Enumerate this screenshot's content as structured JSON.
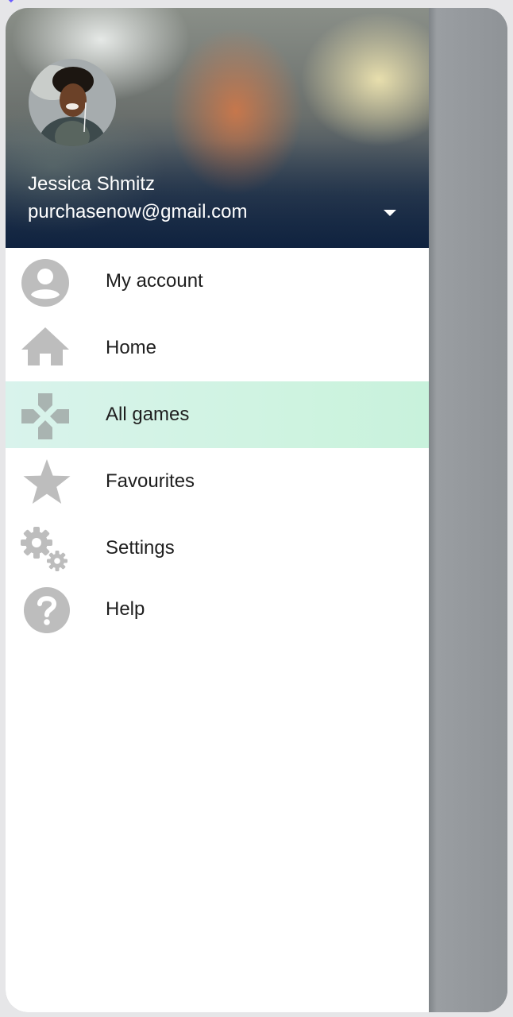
{
  "header": {
    "user_name": "Jessica Shmitz",
    "user_email": "purchasenow@gmail.com"
  },
  "menu": {
    "items": [
      {
        "label": "My account",
        "icon": "account-circle-icon"
      },
      {
        "label": "Home",
        "icon": "home-icon"
      },
      {
        "label": "All games",
        "icon": "gamepad-icon",
        "active": true
      },
      {
        "label": "Favourites",
        "icon": "star-icon"
      },
      {
        "label": "Settings",
        "icon": "settings-icon"
      },
      {
        "label": "Help",
        "icon": "help-icon"
      }
    ]
  },
  "colors": {
    "icon_gray": "#bdbdbd",
    "active_item_bg": "#d2f4e4",
    "scrim": "#8f9397"
  }
}
